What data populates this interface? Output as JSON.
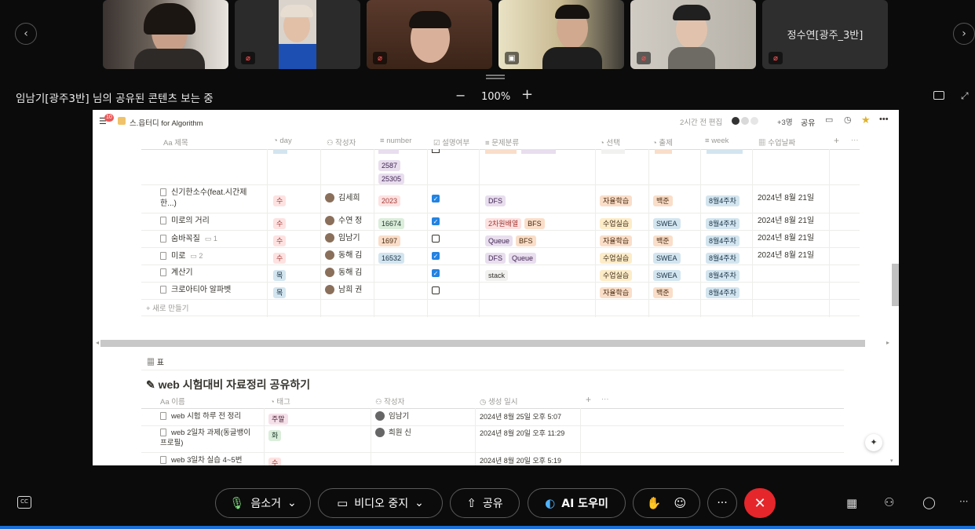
{
  "video_strip": {
    "participants": [
      {
        "muted": false
      },
      {
        "muted": true
      },
      {
        "muted": true
      },
      {
        "muted": false,
        "sharing": true
      },
      {
        "muted": true
      },
      {
        "name": "정수연[광주_3반]",
        "muted": true
      }
    ]
  },
  "share_banner": {
    "text": "임남기[광주3반] 님의 공유된 콘텐츠 보는 중"
  },
  "zoom": {
    "minus": "−",
    "level": "100%",
    "plus": "+"
  },
  "notion": {
    "breadcrumb": "스.읍터디 for Algorithm",
    "notif_count": "10",
    "edited": "2시간 전 편집",
    "collab_count": "+3명",
    "share": "공유",
    "columns": [
      "Aa 제목",
      "day",
      "작성자",
      "number",
      "설명여부",
      "문제분류",
      "선택",
      "출제",
      "week",
      "수업날짜"
    ],
    "partial_row": {
      "numbers": [
        "2587",
        "25305"
      ]
    },
    "rows": [
      {
        "title": "신기한소수(feat.시간제",
        "title2": "한...)",
        "comment": "",
        "day": "수",
        "author": "김세희",
        "number": "2023",
        "checked": true,
        "types": [
          "DFS"
        ],
        "select": "자율학습",
        "source": "백준",
        "week": "8월4주차",
        "date": "2024년 8월 21일"
      },
      {
        "title": "미로의 거리",
        "title2": "",
        "comment": "",
        "day": "수",
        "author": "수연 정",
        "number": "16674",
        "checked": true,
        "types": [
          "2차원배열",
          "BFS"
        ],
        "select": "수업실습",
        "source": "SWEA",
        "week": "8월4주차",
        "date": "2024년 8월 21일"
      },
      {
        "title": "숨바꼭질",
        "title2": "",
        "comment": "1",
        "day": "수",
        "author": "임남기",
        "number": "1697",
        "checked": false,
        "types": [
          "Queue",
          "BFS"
        ],
        "select": "자율학습",
        "source": "백준",
        "week": "8월4주차",
        "date": "2024년 8월 21일"
      },
      {
        "title": "미로",
        "title2": "",
        "comment": "2",
        "day": "수",
        "author": "동해 김",
        "number": "16532",
        "checked": true,
        "types": [
          "DFS",
          "Queue"
        ],
        "select": "수업실습",
        "source": "SWEA",
        "week": "8월4주차",
        "date": "2024년 8월 21일"
      },
      {
        "title": "계산기",
        "title2": "",
        "comment": "",
        "day": "목",
        "author": "동해 김",
        "number": "",
        "checked": true,
        "types": [
          "stack"
        ],
        "select": "수업실습",
        "source": "SWEA",
        "week": "8월4주차",
        "date": ""
      },
      {
        "title": "크로아티아 알파벳",
        "title2": "",
        "comment": "",
        "day": "목",
        "author": "남희 권",
        "number": "",
        "checked": false,
        "types": [],
        "select": "자율학습",
        "source": "백준",
        "week": "8월4주차",
        "date": ""
      }
    ],
    "new_row": "+ 새로 만들기",
    "table2": {
      "view_label": "표",
      "title": "web 시험대비 자료정리 공유하기",
      "columns": [
        "Aa 이름",
        "태그",
        "작성자",
        "생성 일시"
      ],
      "rows": [
        {
          "title": "web 시험 하루 전 정리",
          "title2": "",
          "tag": "주말",
          "author": "임남기",
          "created": "2024년 8월 25일 오후 5:07"
        },
        {
          "title": "web 2일차 과제(동글뱅이",
          "title2": "프로필)",
          "tag": "화",
          "author": "희원 신",
          "created": "2024년 8월 20일 오후 11:29"
        },
        {
          "title": "web 3일차 실습 4~5번",
          "title2": "",
          "tag": "수",
          "author": "",
          "created": "2024년 8월 20일 오후 5:19"
        }
      ]
    }
  },
  "controls": {
    "mute": "음소거",
    "video": "비디오 중지",
    "share": "공유",
    "ai": "AI 도우미",
    "end_color": "#e5262b"
  }
}
